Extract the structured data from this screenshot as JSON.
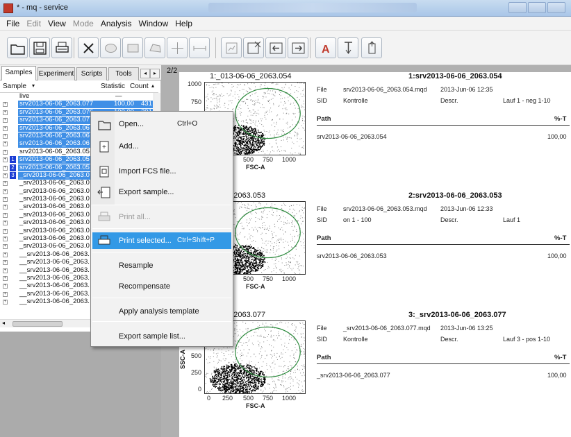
{
  "window": {
    "title": "* - mq - service"
  },
  "menubar": [
    {
      "label": "File",
      "disabled": false
    },
    {
      "label": "Edit",
      "disabled": true
    },
    {
      "label": "View",
      "disabled": false
    },
    {
      "label": "Mode",
      "disabled": true
    },
    {
      "label": "Analysis",
      "disabled": false
    },
    {
      "label": "Window",
      "disabled": false
    },
    {
      "label": "Help",
      "disabled": false
    }
  ],
  "toolbar": {
    "icons": [
      "open-folder-icon",
      "save-icon",
      "print-icon",
      "delete-icon",
      "ellipse-gate-icon",
      "rectangle-gate-icon",
      "polygon-gate-icon",
      "quadrant-gate-icon",
      "interval-gate-icon",
      "new-plot-icon",
      "add-plot-icon",
      "plot-left-icon",
      "plot-right-icon",
      "text-label-icon",
      "import-icon",
      "export-icon"
    ]
  },
  "left_panel": {
    "tabs": [
      "Samples",
      "Experiment",
      "Scripts",
      "Tools"
    ],
    "columns": {
      "sample": "Sample",
      "statistic": "Statistic",
      "count": "Count"
    },
    "rows": [
      {
        "name": "live",
        "stat": "",
        "count": "",
        "selected": false,
        "num": ""
      },
      {
        "name": "srv2013-06-06_2063.077",
        "stat": "100,00",
        "count": "431",
        "selected": true,
        "num": ""
      },
      {
        "name": "srv2013-06-06_2063.076",
        "stat": "100,00",
        "count": "391",
        "selected": true,
        "num": ""
      },
      {
        "name": "srv2013-06-06_2063.07",
        "stat": "",
        "count": "",
        "selected": true,
        "num": ""
      },
      {
        "name": "srv2013-06-06_2063.06",
        "stat": "",
        "count": "",
        "selected": true,
        "num": ""
      },
      {
        "name": "srv2013-06-06_2063.06",
        "stat": "",
        "count": "",
        "selected": true,
        "num": ""
      },
      {
        "name": "srv2013-06-06_2063.06",
        "stat": "",
        "count": "",
        "selected": true,
        "num": ""
      },
      {
        "name": "srv2013-06-06_2063.05",
        "stat": "",
        "count": "",
        "selected": false,
        "num": ""
      },
      {
        "name": "srv2013-06-06_2063.05",
        "stat": "",
        "count": "",
        "selected": true,
        "num": "1"
      },
      {
        "name": "srv2013-06-06_2063.05",
        "stat": "",
        "count": "",
        "selected": true,
        "num": "2"
      },
      {
        "name": "_srv2013-06-06_2063.0",
        "stat": "",
        "count": "",
        "selected": true,
        "num": "3"
      },
      {
        "name": "_srv2013-06-06_2063.0",
        "stat": "",
        "count": "",
        "selected": false,
        "num": ""
      },
      {
        "name": "_srv2013-06-06_2063.0",
        "stat": "",
        "count": "",
        "selected": false,
        "num": ""
      },
      {
        "name": "_srv2013-06-06_2063.0",
        "stat": "",
        "count": "",
        "selected": false,
        "num": ""
      },
      {
        "name": "_srv2013-06-06_2063.0",
        "stat": "",
        "count": "",
        "selected": false,
        "num": ""
      },
      {
        "name": "_srv2013-06-06_2063.0",
        "stat": "",
        "count": "",
        "selected": false,
        "num": ""
      },
      {
        "name": "_srv2013-06-06_2063.0",
        "stat": "",
        "count": "",
        "selected": false,
        "num": ""
      },
      {
        "name": "_srv2013-06-06_2063.0",
        "stat": "",
        "count": "",
        "selected": false,
        "num": ""
      },
      {
        "name": "_srv2013-06-06_2063.0",
        "stat": "",
        "count": "",
        "selected": false,
        "num": ""
      },
      {
        "name": "_srv2013-06-06_2063.0",
        "stat": "",
        "count": "",
        "selected": false,
        "num": ""
      },
      {
        "name": "__srv2013-06-06_2063.",
        "stat": "",
        "count": "",
        "selected": false,
        "num": ""
      },
      {
        "name": "__srv2013-06-06_2063.",
        "stat": "",
        "count": "",
        "selected": false,
        "num": ""
      },
      {
        "name": "__srv2013-06-06_2063.",
        "stat": "",
        "count": "",
        "selected": false,
        "num": ""
      },
      {
        "name": "__srv2013-06-06_2063.",
        "stat": "",
        "count": "",
        "selected": false,
        "num": ""
      },
      {
        "name": "__srv2013-06-06_2063.",
        "stat": "",
        "count": "",
        "selected": false,
        "num": ""
      },
      {
        "name": "__srv2013-06-06_2063.",
        "stat": "",
        "count": "",
        "selected": false,
        "num": ""
      },
      {
        "name": "__srv2013-06-06_2063.",
        "stat": "",
        "count": "",
        "selected": false,
        "num": ""
      }
    ]
  },
  "report": {
    "page_label": "2/2",
    "sections": [
      {
        "plot_title": "1:_013-06-06_2063.054",
        "yticks": [
          "1000",
          "750"
        ],
        "xticks": [
          "500",
          "750",
          "1000"
        ],
        "xlabel": "FSC-A",
        "ylabel": "",
        "info_title": "1:srv2013-06-06_2063.054",
        "file_label": "File",
        "file_value": "srv2013-06-06_2063.054.mqd",
        "date": "2013-Jun-06 12:35",
        "sid_label": "SID",
        "sid_value": "Kontrolle",
        "descr_label": "Descr.",
        "descr_value": "Lauf 1 - neg 1-10",
        "path_label": "Path",
        "pct_label": "%-T",
        "path_value": "srv2013-06-06_2063.054",
        "pct_value": "100,00"
      },
      {
        "plot_title": "06-06_2063.053",
        "yticks": [],
        "xticks": [
          "500",
          "750",
          "1000"
        ],
        "xlabel": "FSC-A",
        "ylabel": "",
        "info_title": "2:srv2013-06-06_2063.053",
        "file_label": "File",
        "file_value": "srv2013-06-06_2063.053.mqd",
        "date": "2013-Jun-06 12:33",
        "sid_label": "SID",
        "sid_value": "on  1 - 100",
        "descr_label": "Descr.",
        "descr_value": "Lauf 1",
        "path_label": "Path",
        "pct_label": "%-T",
        "path_value": "srv2013-06-06_2063.053",
        "pct_value": "100,00"
      },
      {
        "plot_title": "06-06_2063.077",
        "yticks": [
          "500",
          "250",
          "0"
        ],
        "xticks": [
          "0",
          "250",
          "500",
          "750",
          "1000"
        ],
        "xlabel": "FSC-A",
        "ylabel": "SSC-A",
        "info_title": "3:_srv2013-06-06_2063.077",
        "file_label": "File",
        "file_value": "_srv2013-06-06_2063.077.mqd",
        "date": "2013-Jun-06 13:25",
        "sid_label": "SID",
        "sid_value": "Kontrolle",
        "descr_label": "Descr.",
        "descr_value": "Lauf 3 - pos 1-10",
        "path_label": "Path",
        "pct_label": "%-T",
        "path_value": "_srv2013-06-06_2063.077",
        "pct_value": "100,00"
      }
    ]
  },
  "context_menu": {
    "items": [
      {
        "label": "Open...",
        "shortcut": "Ctrl+O",
        "icon": "open-folder-icon",
        "disabled": false,
        "highlighted": false
      },
      {
        "label": "Add...",
        "shortcut": "",
        "icon": "add-file-icon",
        "disabled": false,
        "highlighted": false
      },
      {
        "label": "Import FCS file...",
        "shortcut": "",
        "icon": "import-fcs-icon",
        "disabled": false,
        "highlighted": false
      },
      {
        "label": "Export sample...",
        "shortcut": "",
        "icon": "export-sample-icon",
        "disabled": false,
        "highlighted": false
      },
      {
        "label": "Print all...",
        "shortcut": "",
        "icon": "print-all-icon",
        "disabled": true,
        "highlighted": false
      },
      {
        "label": "Print selected...",
        "shortcut": "Ctrl+Shift+P",
        "icon": "print-selected-icon",
        "disabled": false,
        "highlighted": true
      },
      {
        "label": "Resample",
        "shortcut": "",
        "icon": "",
        "disabled": false,
        "highlighted": false
      },
      {
        "label": "Recompensate",
        "shortcut": "",
        "icon": "",
        "disabled": false,
        "highlighted": false
      },
      {
        "label": "Apply analysis template",
        "shortcut": "",
        "icon": "",
        "disabled": false,
        "highlighted": false
      },
      {
        "label": "Export sample list...",
        "shortcut": "",
        "icon": "",
        "disabled": false,
        "highlighted": false
      }
    ]
  },
  "colors": {
    "selection": "#3f8fe6",
    "highlight": "#3399e6",
    "gate": "#2e8b3e",
    "report_bg": "#b0b0b0"
  }
}
